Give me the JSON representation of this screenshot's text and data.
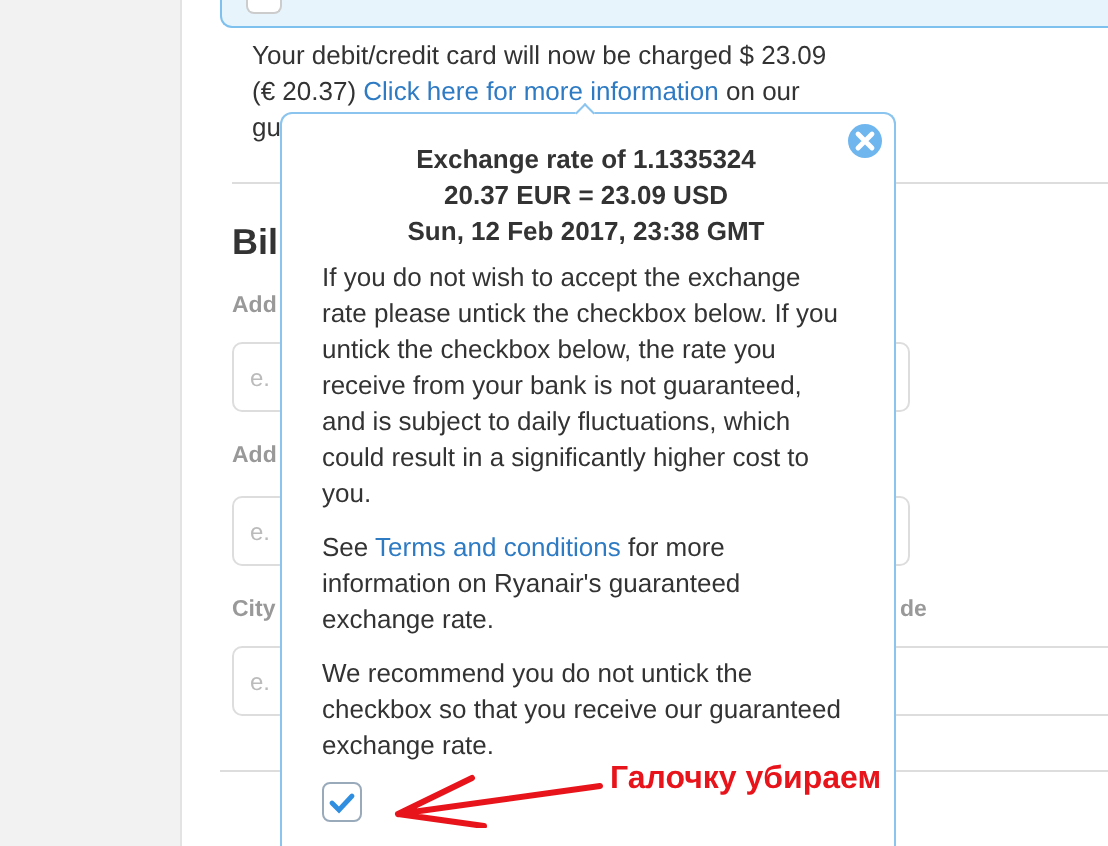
{
  "top_panel": {
    "checkbox": {
      "checked": false
    }
  },
  "charge_notice": {
    "text": "Your debit/credit card will now be charged $ 23.09 (€ 20.37)",
    "link": "Click here for more information",
    "text_after": "on our",
    "cut_text": "gu"
  },
  "billing": {
    "heading": "Bil",
    "fields": [
      {
        "label": "Add",
        "placeholder": "e."
      },
      {
        "label": "Add",
        "placeholder": "e."
      }
    ],
    "row": [
      {
        "label": "City",
        "placeholder": "e."
      },
      {
        "label": "de"
      }
    ]
  },
  "popover": {
    "title_lines": [
      "Exchange rate of 1.1335324",
      "20.37 EUR = 23.09 USD",
      "Sun, 12 Feb 2017, 23:38 GMT"
    ],
    "paragraphs": [
      {
        "text": "If you do not wish to accept the exchange rate please untick the checkbox below. If you untick the checkbox below, the rate you receive from your bank is not guaranteed, and is subject to daily fluctuations, which could result in a significantly higher cost to you."
      },
      {
        "before": "See",
        "link": "Terms and conditions",
        "after": "for more information on Ryanair's guaranteed exchange rate."
      },
      {
        "text": "We recommend you do not untick the checkbox so that you receive our guaranteed exchange rate."
      }
    ],
    "checkbox": {
      "checked": true
    }
  },
  "annotation": {
    "text": "Галочку убираем"
  }
}
